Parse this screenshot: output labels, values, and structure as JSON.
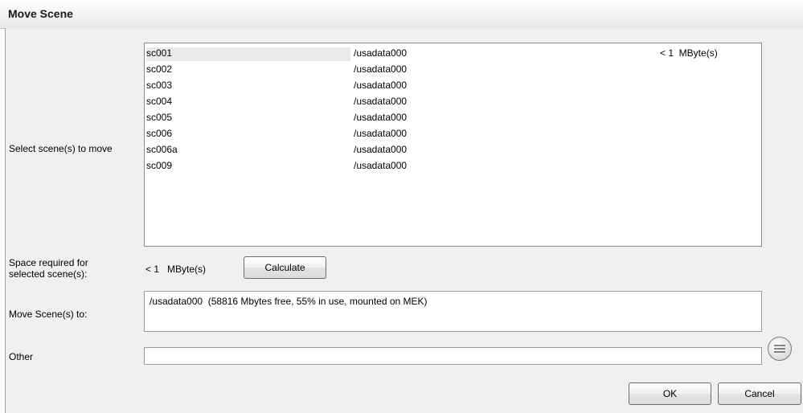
{
  "window": {
    "title": "Move Scene"
  },
  "labels": {
    "select_scenes": "Select scene(s) to move",
    "space_required_line1": "Space required for",
    "space_required_line2": "selected scene(s):",
    "space_value": "< 1   MByte(s)",
    "move_to": "Move Scene(s) to:",
    "other": "Other"
  },
  "scenes": [
    {
      "name": "sc001",
      "path": "/usadata000",
      "size": "< 1  MByte(s)",
      "selected": true
    },
    {
      "name": "sc002",
      "path": "/usadata000",
      "size": ""
    },
    {
      "name": "sc003",
      "path": "/usadata000",
      "size": ""
    },
    {
      "name": "sc004",
      "path": "/usadata000",
      "size": ""
    },
    {
      "name": "sc005",
      "path": "/usadata000",
      "size": ""
    },
    {
      "name": "sc006",
      "path": "/usadata000",
      "size": ""
    },
    {
      "name": "sc006a",
      "path": "/usadata000",
      "size": ""
    },
    {
      "name": "sc009",
      "path": "/usadata000",
      "size": ""
    }
  ],
  "buttons": {
    "calculate": "Calculate",
    "ok": "OK",
    "cancel": "Cancel"
  },
  "move_target": {
    "value": "/usadata000  (58816 Mbytes free, 55% in use, mounted on MEK)"
  },
  "other_input": {
    "value": ""
  },
  "icons": {
    "browse": "list-browse-icon"
  }
}
